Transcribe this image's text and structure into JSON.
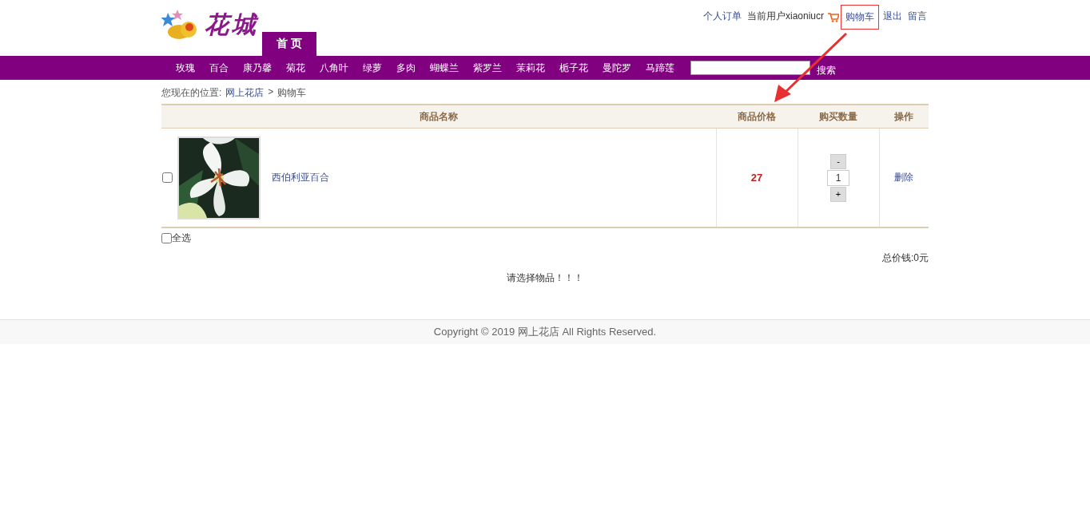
{
  "logo": {
    "text": "花城"
  },
  "top_links": [
    {
      "label": "个人订单",
      "kind": "link",
      "highlighted": false
    },
    {
      "label": "当前用户xiaoniucr",
      "kind": "text",
      "highlighted": false
    },
    {
      "label": "购物车",
      "kind": "cart",
      "highlighted": true
    },
    {
      "label": "退出",
      "kind": "link",
      "highlighted": false
    },
    {
      "label": "留言",
      "kind": "link",
      "highlighted": false
    }
  ],
  "home_tab": {
    "label": "首 页",
    "selected": true
  },
  "categories": [
    "玫瑰",
    "百合",
    "康乃馨",
    "菊花",
    "八角叶",
    "绿萝",
    "多肉",
    "蝴蝶兰",
    "紫罗兰",
    "茉莉花",
    "栀子花",
    "曼陀罗",
    "马蹄莲"
  ],
  "search": {
    "button": "搜索"
  },
  "breadcrumb": {
    "label": "您现在的位置:",
    "items": [
      "网上花店",
      "购物车"
    ],
    "separator": ">"
  },
  "table": {
    "columns": [
      "商品名称",
      "商品价格",
      "购买数量",
      "操作"
    ],
    "rows": [
      {
        "checked": false,
        "kind": "picture",
        "name": "西伯利亚百合",
        "price": "27",
        "minus": "-",
        "quantity": "1",
        "plus": "+",
        "action": "删除"
      }
    ]
  },
  "select_all": {
    "label": "全选",
    "checked": false
  },
  "total": "总价钱:0元",
  "message": "请选择物品！！！",
  "footer": "Copyright © 2019 网上花店 All Rights Reserved."
}
